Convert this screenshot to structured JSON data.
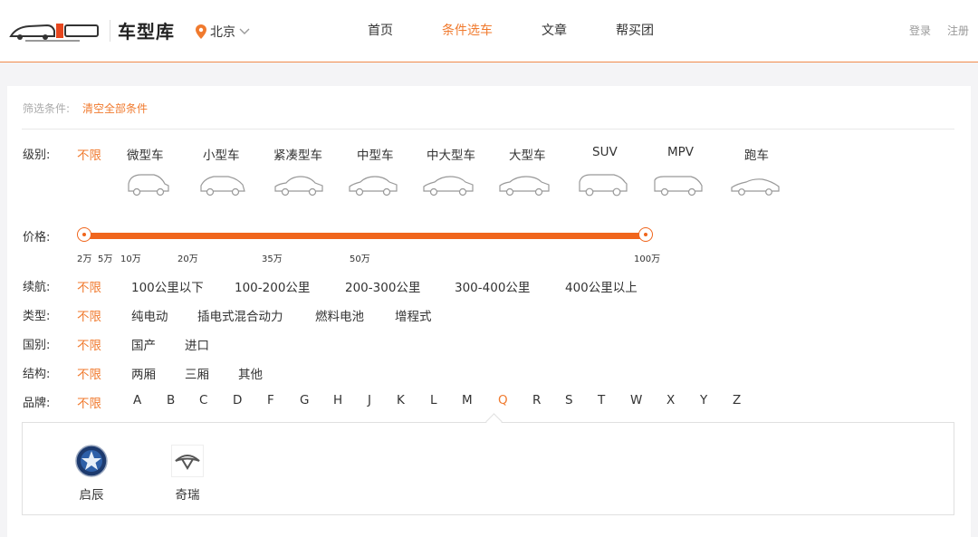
{
  "header": {
    "site_name": "车型库",
    "city": "北京",
    "nav": [
      "首页",
      "条件选车",
      "文章",
      "帮买团"
    ],
    "nav_active_index": 1,
    "login": "登录",
    "register": "注册"
  },
  "filters": {
    "title": "筛选条件:",
    "clear_all": "清空全部条件",
    "level": {
      "label": "级别:",
      "unlimited": "不限",
      "options": [
        "微型车",
        "小型车",
        "紧凑型车",
        "中型车",
        "中大型车",
        "大型车",
        "SUV",
        "MPV",
        "跑车"
      ]
    },
    "price": {
      "label": "价格:",
      "ticks": [
        "2万",
        "5万",
        "10万",
        "20万",
        "35万",
        "50万",
        "100万"
      ],
      "min": "2万",
      "max": "100万"
    },
    "range": {
      "label": "续航:",
      "unlimited": "不限",
      "options": [
        "100公里以下",
        "100-200公里",
        "200-300公里",
        "300-400公里",
        "400公里以上"
      ]
    },
    "type": {
      "label": "类型:",
      "unlimited": "不限",
      "options": [
        "纯电动",
        "插电式混合动力",
        "燃料电池",
        "增程式"
      ]
    },
    "country": {
      "label": "国别:",
      "unlimited": "不限",
      "options": [
        "国产",
        "进口"
      ]
    },
    "structure": {
      "label": "结构:",
      "unlimited": "不限",
      "options": [
        "两厢",
        "三厢",
        "其他"
      ]
    },
    "brand": {
      "label": "品牌:",
      "unlimited": "不限",
      "letters": [
        "A",
        "B",
        "C",
        "D",
        "F",
        "G",
        "H",
        "J",
        "K",
        "L",
        "M",
        "Q",
        "R",
        "S",
        "T",
        "W",
        "X",
        "Y",
        "Z"
      ],
      "selected_letter": "Q",
      "brands": [
        "启辰",
        "奇瑞"
      ]
    }
  },
  "colors": {
    "accent": "#f07a2e",
    "slider": "#f0651c"
  }
}
